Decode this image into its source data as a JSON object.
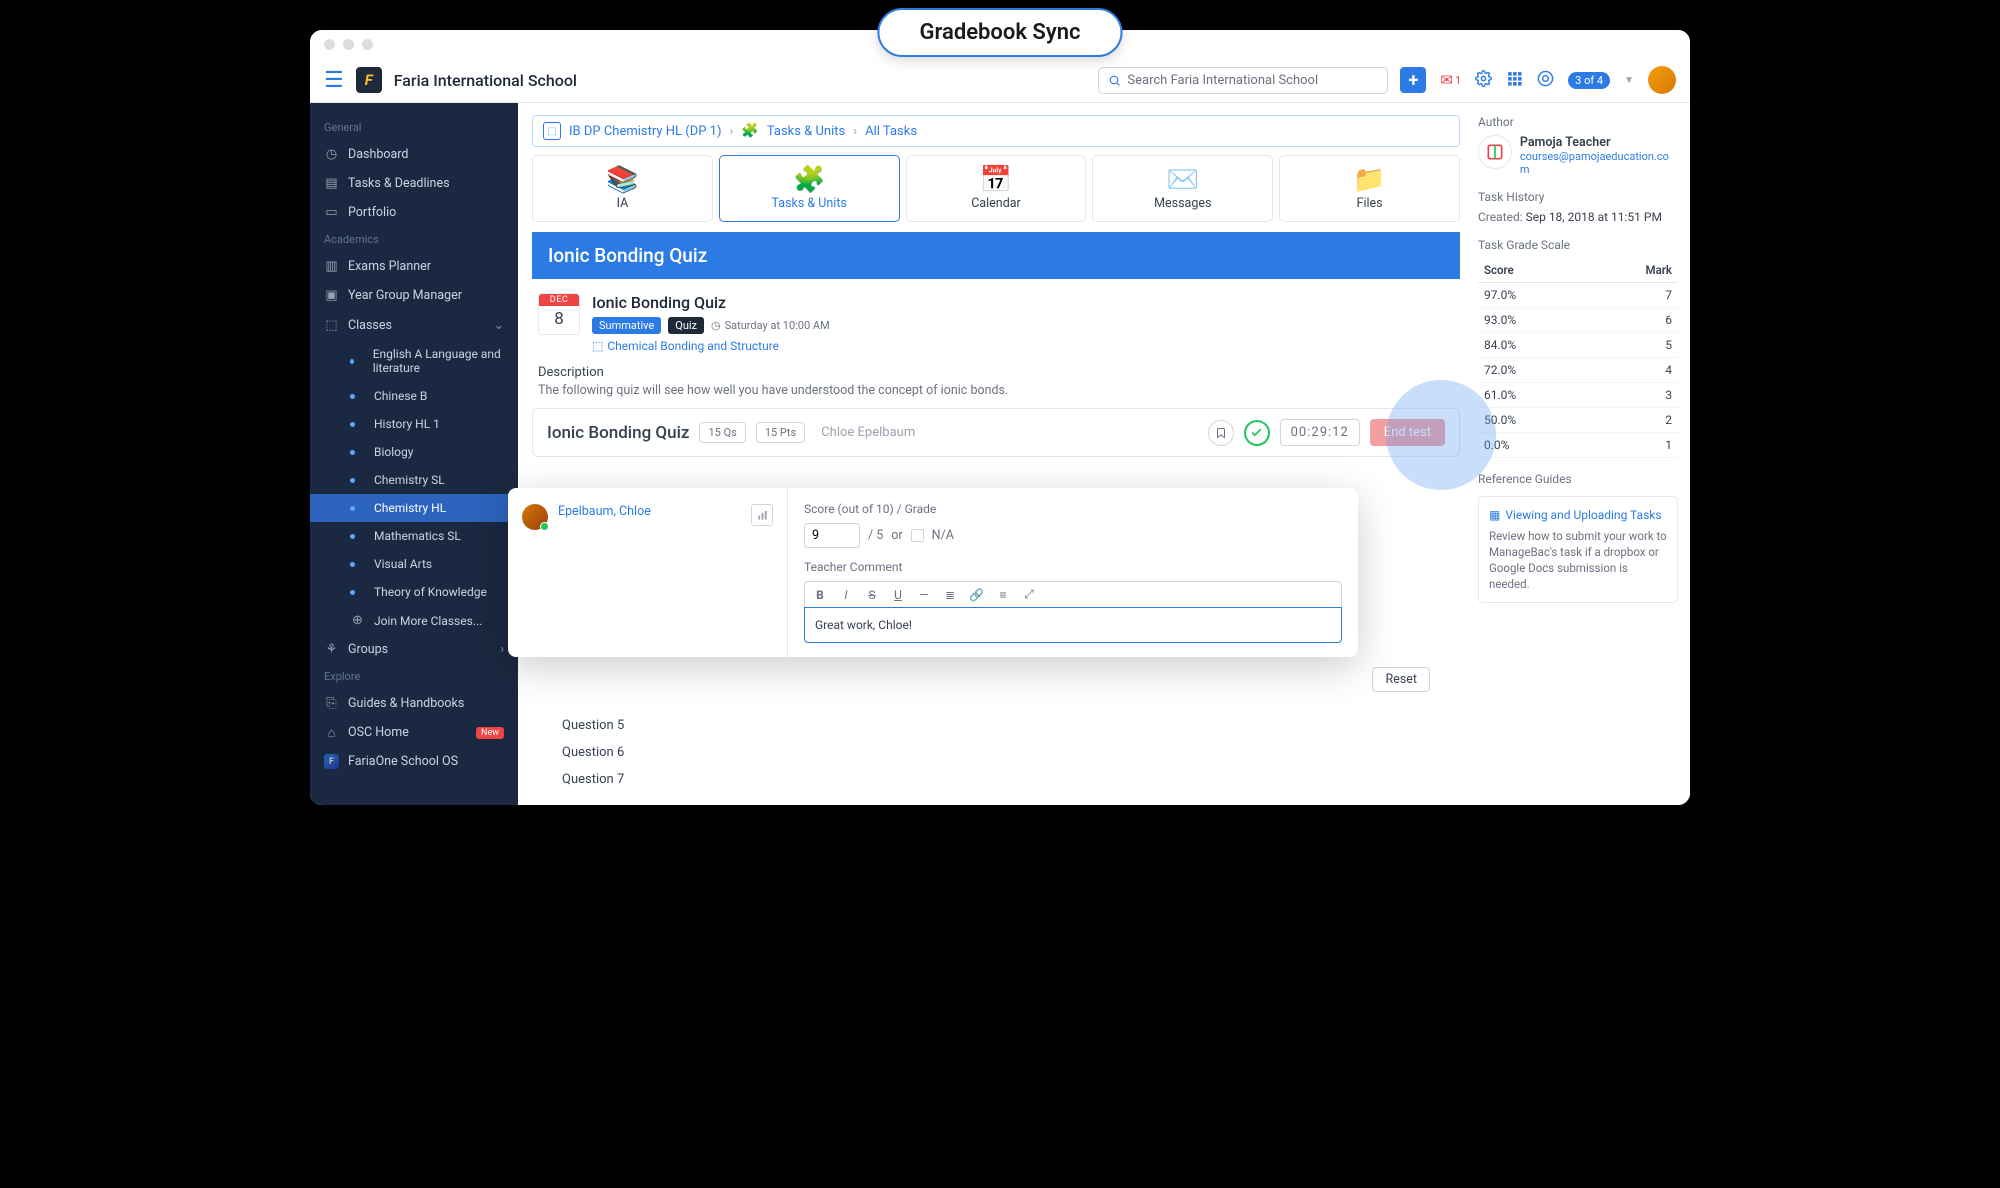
{
  "callout": "Gradebook Sync",
  "topbar": {
    "school": "Faria International School",
    "search_placeholder": "Search Faria International School",
    "mail_count": "1",
    "step_badge": "3 of 4"
  },
  "sidebar": {
    "sections": {
      "general": "General",
      "academics": "Academics",
      "explore": "Explore"
    },
    "items": {
      "dashboard": "Dashboard",
      "tasks_deadlines": "Tasks & Deadlines",
      "portfolio": "Portfolio",
      "exams_planner": "Exams Planner",
      "year_group_manager": "Year Group Manager",
      "classes": "Classes",
      "groups": "Groups",
      "guides": "Guides & Handbooks",
      "osc": "OSC Home",
      "fariaone": "FariaOne School OS",
      "new_badge": "New"
    },
    "class_items": {
      "english": "English A Language and literature",
      "chinese": "Chinese B",
      "history": "History HL 1",
      "biology": "Biology",
      "chem_sl": "Chemistry SL",
      "chem_hl": "Chemistry HL",
      "math_sl": "Mathematics SL",
      "visual_arts": "Visual Arts",
      "tok": "Theory of Knowledge",
      "join": "Join More Classes..."
    }
  },
  "breadcrumb": {
    "class": "IB DP Chemistry HL (DP 1)",
    "section": "Tasks & Units",
    "leaf": "All Tasks"
  },
  "nav_tiles": {
    "ia": "IA",
    "tasks": "Tasks & Units",
    "calendar": "Calendar",
    "messages": "Messages",
    "files": "Files"
  },
  "banner_title": "Ionic Bonding Quiz",
  "task": {
    "date_month": "DEC",
    "date_day": "8",
    "title": "Ionic Bonding Quiz",
    "pill_summative": "Summative",
    "pill_quiz": "Quiz",
    "time": "Saturday at 10:00 AM",
    "unit_link": "Chemical Bonding and Structure",
    "desc_label": "Description",
    "desc_text": "The following quiz will see how well you have understood the concept of ionic bonds."
  },
  "quiz_bar": {
    "title": "Ionic Bonding Quiz",
    "qs": "15 Qs",
    "pts": "15 Pts",
    "student": "Chloe Epelbaum",
    "timer": "00:29:12",
    "end": "End test"
  },
  "grading": {
    "student_name": "Epelbaum, Chloe",
    "score_label": "Score (out of 10) / Grade",
    "score_value": "9",
    "score_max": "/ 5",
    "or": "or",
    "na": "N/A",
    "comment_label": "Teacher Comment",
    "comment_text": "Great work, Chloe!"
  },
  "questions": {
    "q5": "Question 5",
    "q6": "Question 6",
    "q7": "Question 7",
    "reset": "Reset"
  },
  "right": {
    "author_label": "Author",
    "author_name": "Pamoja Teacher",
    "author_email": "courses@pamojaeducation.com",
    "history_label": "Task History",
    "created_label": "Created:",
    "created_value": "Sep 18, 2018 at 11:51 PM",
    "scale_label": "Task Grade Scale",
    "col_score": "Score",
    "col_mark": "Mark",
    "scale": [
      {
        "score": "97.0%",
        "mark": "7"
      },
      {
        "score": "93.0%",
        "mark": "6"
      },
      {
        "score": "84.0%",
        "mark": "5"
      },
      {
        "score": "72.0%",
        "mark": "4"
      },
      {
        "score": "61.0%",
        "mark": "3"
      },
      {
        "score": "50.0%",
        "mark": "2"
      },
      {
        "score": "0.0%",
        "mark": "1"
      }
    ],
    "ref_label": "Reference Guides",
    "ref_link": "Viewing and Uploading Tasks",
    "ref_text": "Review how to submit your work to ManageBac's task if a dropbox or Google Docs submission is needed."
  }
}
